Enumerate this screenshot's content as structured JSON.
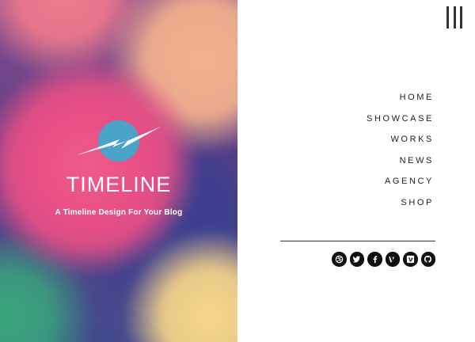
{
  "site": {
    "title": "TIMELINE",
    "tagline": "A Timeline Design For Your Blog",
    "logo_icon": "lightning-circle-icon",
    "logo_color": "#4aa3c8"
  },
  "nav": {
    "items": [
      {
        "label": "HOME"
      },
      {
        "label": "SHOWCASE"
      },
      {
        "label": "WORKS"
      },
      {
        "label": "NEWS"
      },
      {
        "label": "AGENCY"
      },
      {
        "label": "SHOP"
      }
    ]
  },
  "menu_toggle": {
    "icon": "menu-bars-icon"
  },
  "social": {
    "icons": [
      "dribbble-icon",
      "twitter-icon",
      "facebook-icon",
      "vine-icon",
      "vimeo-icon",
      "github-icon"
    ]
  }
}
